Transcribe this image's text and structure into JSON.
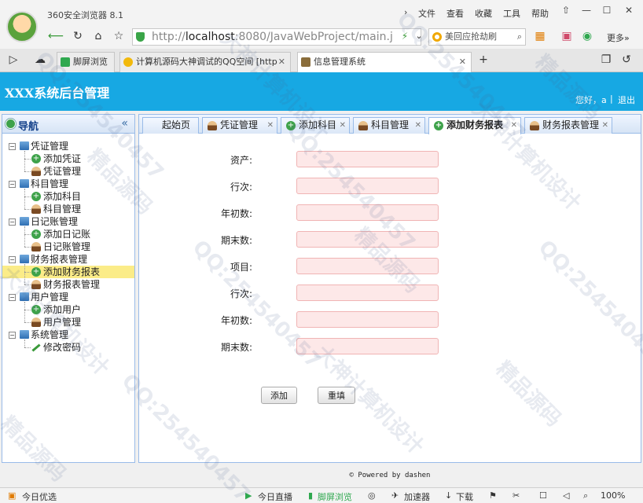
{
  "browser": {
    "name": "360安全浏览器 8.1",
    "menus": [
      "文件",
      "查看",
      "收藏",
      "工具",
      "帮助"
    ],
    "url_prefix": "http://",
    "url_host": "localhost",
    "url_rest": ":8080/JavaWebProject/main.j",
    "search_text": "美回应抢劫刷",
    "more": "更多»",
    "tabs": [
      {
        "label": "脚屏浏览",
        "color": "#2fa84f"
      },
      {
        "label": "计算机源码大神调试的QQ空间 [http:",
        "color": "#f2b90c"
      },
      {
        "label": "信息管理系统",
        "color": "#8a6d3b"
      }
    ]
  },
  "app": {
    "title": "XXX系统后台管理",
    "greeting": "您好，a",
    "separator": "|",
    "logout": "退出"
  },
  "nav": {
    "title": "导航",
    "collapse": "«",
    "groups": [
      {
        "label": "凭证管理",
        "items": [
          {
            "label": "添加凭证",
            "icon": "add"
          },
          {
            "label": "凭证管理",
            "icon": "user"
          }
        ]
      },
      {
        "label": "科目管理",
        "items": [
          {
            "label": "添加科目",
            "icon": "add"
          },
          {
            "label": "科目管理",
            "icon": "user"
          }
        ]
      },
      {
        "label": "日记账管理",
        "items": [
          {
            "label": "添加日记账",
            "icon": "add"
          },
          {
            "label": "日记账管理",
            "icon": "user"
          }
        ]
      },
      {
        "label": "财务报表管理",
        "items": [
          {
            "label": "添加财务报表",
            "icon": "add"
          },
          {
            "label": "财务报表管理",
            "icon": "user"
          }
        ]
      },
      {
        "label": "用户管理",
        "items": [
          {
            "label": "添加用户",
            "icon": "add"
          },
          {
            "label": "用户管理",
            "icon": "user"
          }
        ]
      },
      {
        "label": "系统管理",
        "items": [
          {
            "label": "修改密码",
            "icon": "pen"
          }
        ]
      }
    ],
    "selected": "添加财务报表"
  },
  "tabs": [
    {
      "label": "起始页",
      "icon": "",
      "closable": false
    },
    {
      "label": "凭证管理",
      "icon": "user",
      "closable": true
    },
    {
      "label": "添加科目",
      "icon": "add",
      "closable": true
    },
    {
      "label": "科目管理",
      "icon": "user",
      "closable": true
    },
    {
      "label": "添加财务报表",
      "icon": "add",
      "closable": true,
      "active": true
    },
    {
      "label": "财务报表管理",
      "icon": "user",
      "closable": true
    }
  ],
  "form": {
    "fields": [
      {
        "label": "资产:",
        "value": ""
      },
      {
        "label": "行次:",
        "value": ""
      },
      {
        "label": "年初数:",
        "value": ""
      },
      {
        "label": "期末数:",
        "value": ""
      },
      {
        "label": "项目:",
        "value": ""
      },
      {
        "label": "行次:",
        "value": ""
      },
      {
        "label": "年初数:",
        "value": ""
      },
      {
        "label": "期末数:",
        "value": ""
      }
    ],
    "submit": "添加",
    "reset": "重填"
  },
  "footer": "© Powered by dashen",
  "statusbar": {
    "left": "今日优选",
    "live": "今日直播",
    "screen": "脚屏浏览",
    "accel": "加速器",
    "download": "下载",
    "zoom": "100%"
  },
  "watermarks": [
    "QQ:254540457",
    "大神计算机设计",
    "精品源码"
  ]
}
